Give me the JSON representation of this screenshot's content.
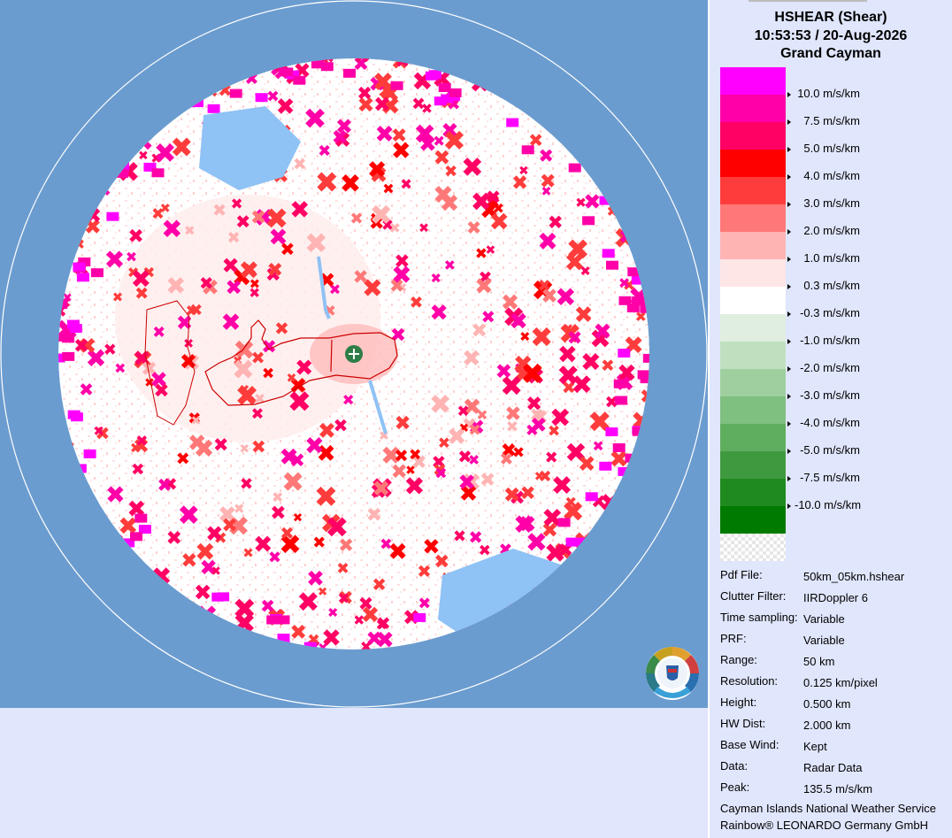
{
  "product": {
    "title": "HSHEAR (Shear)",
    "datetime": "10:53:53 / 20-Aug-2026",
    "site": "Grand Cayman"
  },
  "legend": [
    {
      "label": "10.0 m/s/km",
      "color": "#ff00ff"
    },
    {
      "label": "7.5 m/s/km",
      "color": "#ff00a8"
    },
    {
      "label": "5.0 m/s/km",
      "color": "#ff0064"
    },
    {
      "label": "4.0 m/s/km",
      "color": "#ff0000"
    },
    {
      "label": "3.0 m/s/km",
      "color": "#ff3c3c"
    },
    {
      "label": "2.0 m/s/km",
      "color": "#ff7878"
    },
    {
      "label": "1.0 m/s/km",
      "color": "#ffb4b4"
    },
    {
      "label": "0.3 m/s/km",
      "color": "#ffe6e6"
    },
    {
      "label": "-0.3 m/s/km",
      "color": "#ffffff"
    },
    {
      "label": "-1.0 m/s/km",
      "color": "#dfeedf"
    },
    {
      "label": "-2.0 m/s/km",
      "color": "#bfe0bf"
    },
    {
      "label": "-3.0 m/s/km",
      "color": "#9fcf9f"
    },
    {
      "label": "-4.0 m/s/km",
      "color": "#7fbf7f"
    },
    {
      "label": "-5.0 m/s/km",
      "color": "#5fae5f"
    },
    {
      "label": "-7.5 m/s/km",
      "color": "#3f9a3f"
    },
    {
      "label": "-10.0 m/s/km",
      "color": "#1f8a1f"
    },
    {
      "label": "",
      "color": "#007a00"
    }
  ],
  "info": [
    {
      "key": "Pdf File:",
      "value": "50km_05km.hshear"
    },
    {
      "key": "Clutter Filter:",
      "value": "IIRDoppler 6"
    },
    {
      "key": "Time sampling:",
      "value": "Variable"
    },
    {
      "key": "PRF:",
      "value": "Variable"
    },
    {
      "key": "Range:",
      "value": "50 km"
    },
    {
      "key": "Resolution:",
      "value": "0.125 km/pixel"
    },
    {
      "key": "Height:",
      "value": "0.500 km"
    },
    {
      "key": "HW Dist:",
      "value": "2.000 km"
    },
    {
      "key": "Base Wind:",
      "value": "Kept"
    },
    {
      "key": "Data:",
      "value": "Radar Data"
    },
    {
      "key": "Peak:",
      "value": "135.5 m/s/km"
    }
  ],
  "credits": [
    "Cayman Islands National Weather Service",
    "Rainbow® LEONARDO Germany GmbH"
  ],
  "colors": {
    "ocean": "#6b9ccf",
    "panel": "#e0e6fc",
    "coastline": "#cc0000",
    "radar_site": "#2e7d46",
    "clear_sky": "#8fc2f5"
  },
  "icons": [
    "radar-site-icon",
    "weather-service-logo"
  ]
}
